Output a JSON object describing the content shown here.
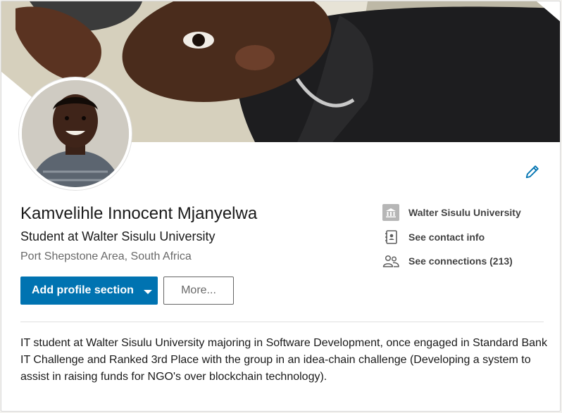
{
  "profile": {
    "name": "Kamvelihle Innocent Mjanyelwa",
    "headline": "Student at Walter Sisulu University",
    "location": "Port Shepstone Area, South Africa",
    "summary": "IT student at Walter Sisulu University majoring in Software Development, once engaged in Standard Bank IT Challenge and Ranked 3rd Place with the group in an idea-chain challenge (Developing a system to assist in raising funds for NGO's over blockchain technology)."
  },
  "actions": {
    "add_section_label": "Add profile section",
    "more_label": "More..."
  },
  "side": {
    "school": "Walter Sisulu University",
    "contact": "See contact info",
    "connections": "See connections (213)"
  },
  "colors": {
    "primary": "#0073b1",
    "text": "#000000"
  },
  "icons": [
    "pencil-icon",
    "school-icon",
    "contact-card-icon",
    "people-icon",
    "chevron-down-icon"
  ]
}
